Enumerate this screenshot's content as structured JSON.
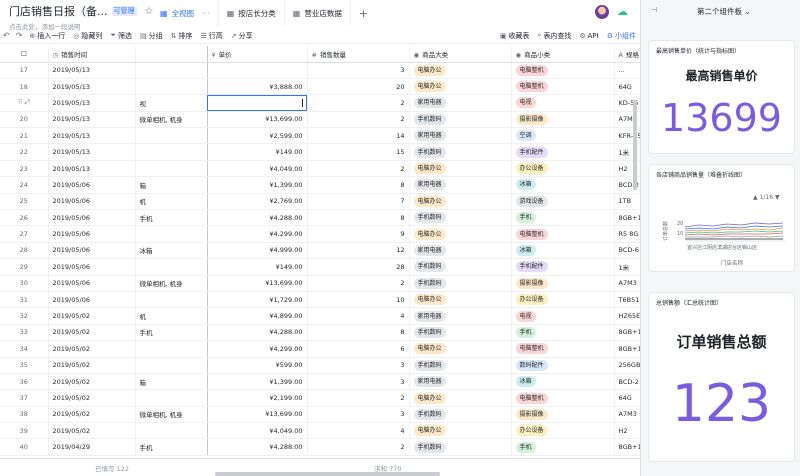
{
  "header": {
    "title": "门店销售日报（备...",
    "badge": "可管理",
    "description": "点击此处，添加一段说明",
    "tabs": [
      {
        "label": "全视图",
        "active": true
      },
      {
        "label": "按店长分类",
        "active": false
      },
      {
        "label": "营业店数据",
        "active": false
      }
    ]
  },
  "toolbar": {
    "insert_row": "插入一行",
    "hide_cols": "隐藏列",
    "filter": "筛选",
    "group": "分组",
    "sort": "排序",
    "row_height": "行高",
    "share": "分享",
    "favorites": "收藏表",
    "table_search": "表内查找",
    "api": "API",
    "widget": "小组件"
  },
  "columns": {
    "date": "销售时间",
    "unit_price": "单价",
    "quantity": "销售数量",
    "category": "商品大类",
    "subcategory": "商品小类",
    "spec": "规格"
  },
  "rows": [
    {
      "no": "17",
      "date": "2019/05/13",
      "name": "",
      "price": "",
      "qty": "3",
      "cat": "电脑办公",
      "catc": "t-office",
      "sub": "电脑整机",
      "subc": "s-pink",
      "spec": "..."
    },
    {
      "no": "18",
      "date": "2019/05/13",
      "name": "",
      "price": "¥3,888.00",
      "qty": "20",
      "cat": "电脑办公",
      "catc": "t-office",
      "sub": "电脑整机",
      "subc": "s-pink",
      "spec": "64G"
    },
    {
      "no": "",
      "date": "2019/05/13",
      "name": "视",
      "price": "",
      "qty": "2",
      "cat": "家用电器",
      "catc": "t-electric",
      "sub": "电视",
      "subc": "s-pink",
      "spec": "KD-55"
    },
    {
      "no": "20",
      "date": "2019/05/13",
      "name": "微单相机, 机身",
      "price": "¥13,699.00",
      "qty": "2",
      "cat": "手机数码",
      "catc": "t-phone",
      "sub": "摄影摄像",
      "subc": "s-orange",
      "spec": "A7M3"
    },
    {
      "no": "21",
      "date": "2019/05/13",
      "name": "",
      "price": "¥2,599.00",
      "qty": "14",
      "cat": "家用电器",
      "catc": "t-electric",
      "sub": "空调",
      "subc": "s-blue",
      "spec": "KFR-35"
    },
    {
      "no": "22",
      "date": "2019/05/13",
      "name": "",
      "price": "¥149.00",
      "qty": "15",
      "cat": "手机数码",
      "catc": "t-phone",
      "sub": "手机配件",
      "subc": "s-purple",
      "spec": "1米"
    },
    {
      "no": "23",
      "date": "2019/05/13",
      "name": "",
      "price": "¥4,049.00",
      "qty": "2",
      "cat": "电脑办公",
      "catc": "t-office",
      "sub": "办公设备",
      "subc": "s-yellow",
      "spec": "H2"
    },
    {
      "no": "24",
      "date": "2019/05/06",
      "name": "箱",
      "price": "¥1,399.00",
      "qty": "8",
      "cat": "家用电器",
      "catc": "t-electric",
      "sub": "冰箱",
      "subc": "s-teal",
      "spec": "BCD-2"
    },
    {
      "no": "25",
      "date": "2019/05/06",
      "name": "机",
      "price": "¥2,769.00",
      "qty": "7",
      "cat": "电脑办公",
      "catc": "t-office",
      "sub": "游戏设备",
      "subc": "s-gray",
      "spec": "1TB"
    },
    {
      "no": "26",
      "date": "2019/05/06",
      "name": "手机",
      "price": "¥4,288.00",
      "qty": "8",
      "cat": "手机数码",
      "catc": "t-phone",
      "sub": "手机",
      "subc": "s-green",
      "spec": "8GB+1"
    },
    {
      "no": "27",
      "date": "2019/05/06",
      "name": "",
      "price": "¥4,299.00",
      "qty": "9",
      "cat": "电脑办公",
      "catc": "t-office",
      "sub": "电脑整机",
      "subc": "s-pink",
      "spec": "R5 8G"
    },
    {
      "no": "28",
      "date": "2019/05/06",
      "name": "冰箱",
      "price": "¥4,999.00",
      "qty": "12",
      "cat": "家用电器",
      "catc": "t-electric",
      "sub": "冰箱",
      "subc": "s-teal",
      "spec": "BCD-6"
    },
    {
      "no": "29",
      "date": "2019/05/06",
      "name": "",
      "price": "¥149.00",
      "qty": "28",
      "cat": "手机数码",
      "catc": "t-phone",
      "sub": "手机配件",
      "subc": "s-purple",
      "spec": "1米"
    },
    {
      "no": "30",
      "date": "2019/05/06",
      "name": "微单相机, 机身",
      "price": "¥13,699.00",
      "qty": "2",
      "cat": "手机数码",
      "catc": "t-phone",
      "sub": "摄影摄像",
      "subc": "s-orange",
      "spec": "A7M3"
    },
    {
      "no": "31",
      "date": "2019/05/06",
      "name": "",
      "price": "¥1,729.00",
      "qty": "10",
      "cat": "电脑办公",
      "catc": "t-office",
      "sub": "办公设备",
      "subc": "s-yellow",
      "spec": "T6B51"
    },
    {
      "no": "32",
      "date": "2019/05/02",
      "name": "机",
      "price": "¥4,899.00",
      "qty": "4",
      "cat": "家用电器",
      "catc": "t-electric",
      "sub": "电视",
      "subc": "s-pink",
      "spec": "HZ65E"
    },
    {
      "no": "33",
      "date": "2019/05/02",
      "name": "手机",
      "price": "¥4,288.00",
      "qty": "8",
      "cat": "手机数码",
      "catc": "t-phone",
      "sub": "手机",
      "subc": "s-green",
      "spec": "8GB+1"
    },
    {
      "no": "34",
      "date": "2019/05/02",
      "name": "",
      "price": "¥4,299.00",
      "qty": "6",
      "cat": "电脑办公",
      "catc": "t-office",
      "sub": "电脑整机",
      "subc": "s-pink",
      "spec": "8GB+1"
    },
    {
      "no": "35",
      "date": "2019/05/02",
      "name": "",
      "price": "¥599.00",
      "qty": "3",
      "cat": "手机数码",
      "catc": "t-phone",
      "sub": "数码配件",
      "subc": "s-blue",
      "spec": "256GB"
    },
    {
      "no": "36",
      "date": "2019/05/02",
      "name": "箱",
      "price": "¥1,399.00",
      "qty": "3",
      "cat": "家用电器",
      "catc": "t-electric",
      "sub": "冰箱",
      "subc": "s-teal",
      "spec": "BCD-2"
    },
    {
      "no": "37",
      "date": "2019/05/02",
      "name": "",
      "price": "¥2,199.00",
      "qty": "2",
      "cat": "电脑办公",
      "catc": "t-office",
      "sub": "电脑整机",
      "subc": "s-pink",
      "spec": "64G"
    },
    {
      "no": "38",
      "date": "2019/05/02",
      "name": "微单相机, 机身",
      "price": "¥13,699.00",
      "qty": "3",
      "cat": "手机数码",
      "catc": "t-phone",
      "sub": "摄影摄像",
      "subc": "s-orange",
      "spec": "A7M3"
    },
    {
      "no": "39",
      "date": "2019/05/02",
      "name": "",
      "price": "¥4,049.00",
      "qty": "4",
      "cat": "电脑办公",
      "catc": "t-office",
      "sub": "办公设备",
      "subc": "s-yellow",
      "spec": "H2"
    },
    {
      "no": "40",
      "date": "2019/04/29",
      "name": "手机",
      "price": "¥4,288.00",
      "qty": "2",
      "cat": "手机数码",
      "catc": "t-phone",
      "sub": "手机",
      "subc": "s-green",
      "spec": "8GB+1"
    }
  ],
  "footer": {
    "filled": "已填写 122",
    "sum": "求和 770"
  },
  "panel": {
    "title": "第二个组件板",
    "card1": {
      "label": "最高销售单价（统计与指标图）",
      "title": "最高销售单价",
      "value": "13699"
    },
    "card2": {
      "label": "各店铺商品销售量（堆叠折线图）",
      "pager": "1/16",
      "ylabel": "订单总数",
      "xlabel": "门店名称",
      "ytick_top": "20",
      "ytick_mid": "10",
      "xticks": "宜兴店江阴店滨湖店台店锡山店"
    },
    "card3": {
      "label": "总销售额（汇总统计图）",
      "title": "订单销售总额",
      "value": "123"
    }
  },
  "colors": {
    "accent": "#3370ff",
    "stat": "#7b5ce0"
  }
}
